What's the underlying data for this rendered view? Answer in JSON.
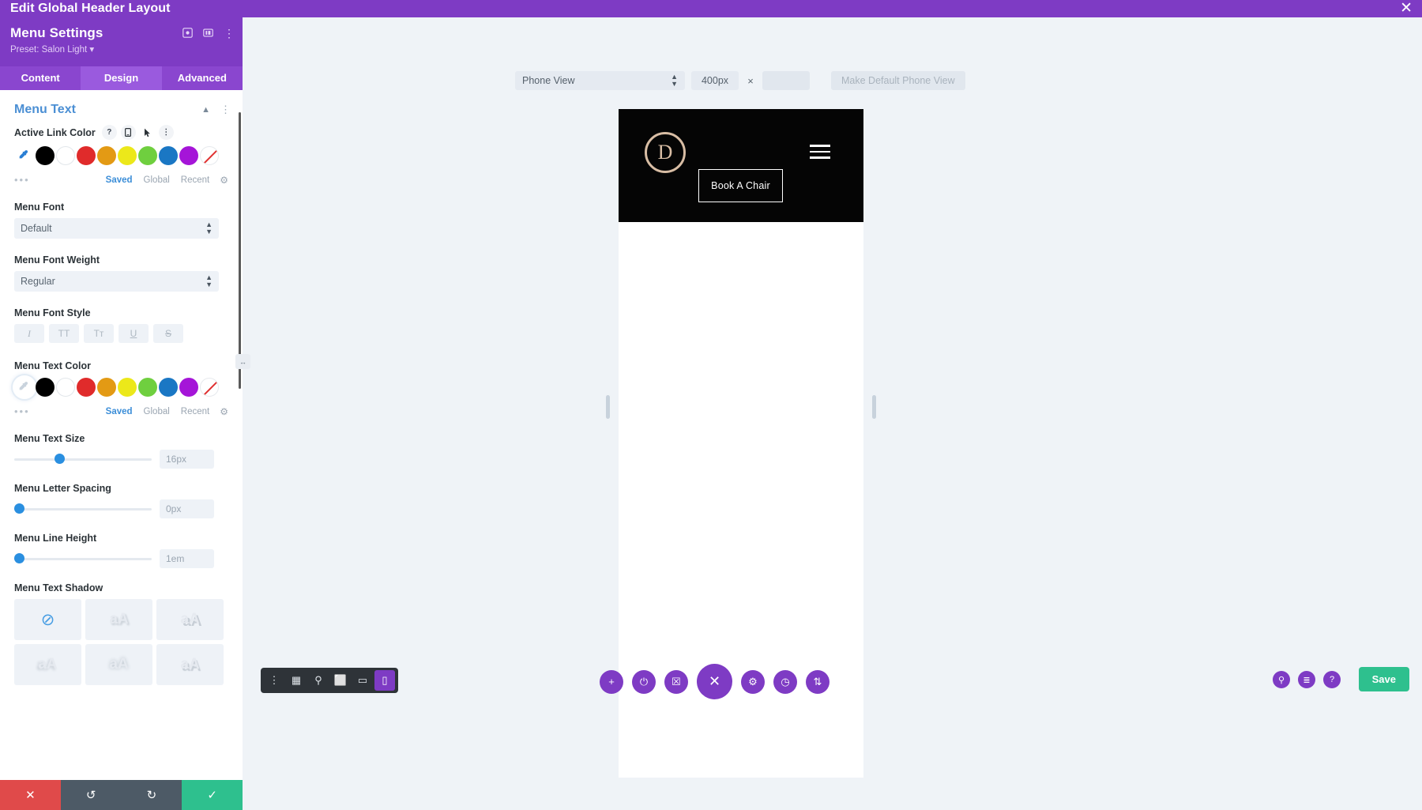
{
  "window": {
    "title": "Edit Global Header Layout",
    "close_icon": "close-icon"
  },
  "panel": {
    "title": "Menu Settings",
    "preset": "Preset: Salon Light ▾",
    "head_icons": [
      "target-icon",
      "layout-columns-icon",
      "more-vertical-icon"
    ],
    "tabs": [
      {
        "label": "Content",
        "active": false
      },
      {
        "label": "Design",
        "active": true
      },
      {
        "label": "Advanced",
        "active": false
      }
    ],
    "section": {
      "title": "Menu Text",
      "collapse_icon": "chevron-up-icon",
      "more_icon": "more-vertical-icon"
    },
    "fields": {
      "active_link_color": {
        "label": "Active Link Color",
        "label_icons": [
          "help-icon",
          "responsive-phone-icon",
          "hover-cursor-icon",
          "more-vertical-icon"
        ],
        "swatches": [
          "#000000",
          "#ffffff",
          "#e02b2b",
          "#e39a14",
          "#ece81a",
          "#6fcf3f",
          "#1a77c4",
          "#a515d8",
          "none"
        ],
        "eyedropper_icon": "eyedropper-icon",
        "eyedropper_selected": false,
        "meta": {
          "dots": "•••",
          "saved": "Saved",
          "global": "Global",
          "recent": "Recent",
          "gear": "gear-icon"
        }
      },
      "menu_font": {
        "label": "Menu Font",
        "value": "Default"
      },
      "menu_font_weight": {
        "label": "Menu Font Weight",
        "value": "Regular"
      },
      "menu_font_style": {
        "label": "Menu Font Style",
        "buttons": [
          {
            "name": "italic",
            "glyph": "I"
          },
          {
            "name": "uppercase",
            "glyph": "TT"
          },
          {
            "name": "capitalize",
            "glyph": "Tᴛ"
          },
          {
            "name": "underline",
            "glyph": "U"
          },
          {
            "name": "strikethrough",
            "glyph": "S"
          }
        ]
      },
      "menu_text_color": {
        "label": "Menu Text Color",
        "swatches": [
          "#000000",
          "#ffffff",
          "#e02b2b",
          "#e39a14",
          "#ece81a",
          "#6fcf3f",
          "#1a77c4",
          "#a515d8",
          "none"
        ],
        "eyedropper_icon": "eyedropper-icon",
        "eyedropper_selected": true,
        "meta": {
          "dots": "•••",
          "saved": "Saved",
          "global": "Global",
          "recent": "Recent",
          "gear": "gear-icon"
        }
      },
      "menu_text_size": {
        "label": "Menu Text Size",
        "value": "16px",
        "knob_pct": 33
      },
      "menu_letter_spacing": {
        "label": "Menu Letter Spacing",
        "value": "0px",
        "knob_pct": 0
      },
      "menu_line_height": {
        "label": "Menu Line Height",
        "value": "1em",
        "knob_pct": 0
      },
      "menu_text_shadow": {
        "label": "Menu Text Shadow",
        "tiles": [
          {
            "name": "none",
            "glyph": "⊘"
          },
          {
            "name": "shadow-1",
            "glyph": "aA"
          },
          {
            "name": "shadow-2",
            "glyph": "aA"
          },
          {
            "name": "shadow-3",
            "glyph": "aA"
          },
          {
            "name": "shadow-4",
            "glyph": "aA"
          },
          {
            "name": "shadow-5",
            "glyph": "aA"
          }
        ]
      }
    },
    "footer": [
      {
        "name": "discard",
        "glyph": "✕",
        "color": "red"
      },
      {
        "name": "undo",
        "glyph": "↺",
        "color": "gray"
      },
      {
        "name": "redo",
        "glyph": "↻",
        "color": "gray"
      },
      {
        "name": "save",
        "glyph": "✓",
        "color": "green"
      }
    ],
    "resize_handle": "↔"
  },
  "canvas": {
    "view_toolbar": {
      "view_select": "Phone View",
      "width_value": "400px",
      "separator": "×",
      "height_value": "",
      "make_default_label": "Make Default Phone View"
    },
    "preview": {
      "logo_letter": "D",
      "logo_color": "#d8bda4",
      "book_button": "Book A Chair",
      "menu_icon": "hamburger-icon",
      "header_bg": "#050505"
    },
    "mini_toolbar": [
      {
        "name": "more-vertical-icon",
        "glyph": "⋮",
        "active": false
      },
      {
        "name": "wireframe-icon",
        "glyph": "▦",
        "active": false
      },
      {
        "name": "zoom-out-icon",
        "glyph": "⚲",
        "active": false
      },
      {
        "name": "desktop-view-icon",
        "glyph": "⬜",
        "active": false
      },
      {
        "name": "tablet-view-icon",
        "glyph": "▭",
        "active": false
      },
      {
        "name": "phone-view-icon",
        "glyph": "▯",
        "active": true
      }
    ],
    "fab_row": [
      {
        "name": "add-icon",
        "glyph": "+",
        "big": false
      },
      {
        "name": "power-icon",
        "glyph": "⏻",
        "big": false
      },
      {
        "name": "trash-icon",
        "glyph": "☒",
        "big": false
      },
      {
        "name": "close-builder-icon",
        "glyph": "✕",
        "big": true
      },
      {
        "name": "settings-icon",
        "glyph": "⚙",
        "big": false
      },
      {
        "name": "history-icon",
        "glyph": "◷",
        "big": false
      },
      {
        "name": "portability-icon",
        "glyph": "⇅",
        "big": false
      }
    ],
    "bottom_right_icons": [
      {
        "name": "search-icon",
        "glyph": "⚲"
      },
      {
        "name": "layers-icon",
        "glyph": "≣"
      },
      {
        "name": "help-icon",
        "glyph": "?"
      }
    ],
    "save_label": "Save"
  },
  "colors": {
    "brand_purple": "#7e3bc4",
    "accent_blue": "#3c8ed8",
    "save_green": "#2ec08e"
  }
}
